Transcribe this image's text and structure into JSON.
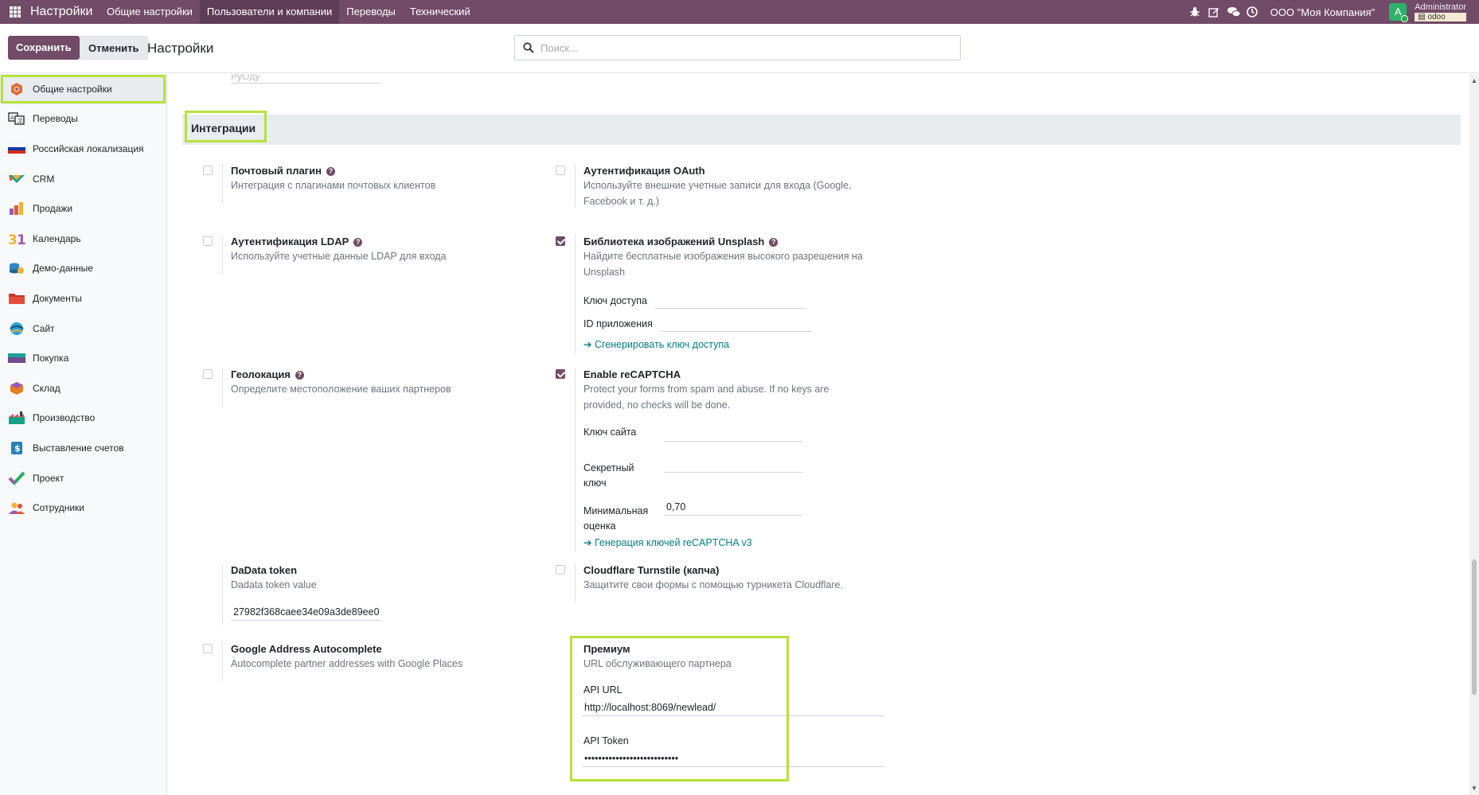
{
  "topbar": {
    "app_name": "Настройки",
    "menu": [
      "Общие настройки",
      "Пользователи и компании",
      "Переводы",
      "Технический"
    ],
    "active_menu_index": 1,
    "company": "ООО \"Моя Компания\"",
    "avatar_letter": "A",
    "user_name": "Administrator",
    "db_name": "odoo",
    "tray_icons": [
      "bug-icon",
      "edit-icon",
      "chat-icon",
      "clock-icon"
    ]
  },
  "control": {
    "save_label": "Сохранить",
    "cancel_label": "Отменить",
    "title": "Настройки",
    "search_placeholder": "Поиск..."
  },
  "sidebar": {
    "items": [
      {
        "label": "Общие настройки",
        "icon": "settings-app-icon",
        "color": "#e06a3b",
        "active": true
      },
      {
        "label": "Переводы",
        "icon": "translate-icon",
        "color": "#333333"
      },
      {
        "label": "Российская локализация",
        "icon": "russia-flag-icon",
        "color": "#d52b1e"
      },
      {
        "label": "CRM",
        "icon": "crm-icon",
        "color": "#1aa29b"
      },
      {
        "label": "Продажи",
        "icon": "sales-icon",
        "color": "#e65a2c"
      },
      {
        "label": "Календарь",
        "icon": "calendar-icon",
        "color": "#e67e22"
      },
      {
        "label": "Демо-данные",
        "icon": "demo-data-icon",
        "color": "#2e86c1"
      },
      {
        "label": "Документы",
        "icon": "documents-icon",
        "color": "#c0392b"
      },
      {
        "label": "Сайт",
        "icon": "website-icon",
        "color": "#2aa3d6"
      },
      {
        "label": "Покупка",
        "icon": "purchase-icon",
        "color": "#6d4b8d"
      },
      {
        "label": "Склад",
        "icon": "inventory-icon",
        "color": "#e67e22"
      },
      {
        "label": "Производство",
        "icon": "manufacturing-icon",
        "color": "#16a085"
      },
      {
        "label": "Выставление счетов",
        "icon": "invoicing-icon",
        "color": "#2980b9"
      },
      {
        "label": "Проект",
        "icon": "project-icon",
        "color": "#27ae60"
      },
      {
        "label": "Сотрудники",
        "icon": "employees-icon",
        "color": "#9b59b6"
      }
    ]
  },
  "main": {
    "prev_field_value": "PyOдy",
    "section_title": "Интеграции",
    "mail_plugin": {
      "title": "Почтовый плагин",
      "desc": "Интеграция с плагинами почтовых клиентов",
      "checked": false
    },
    "oauth": {
      "title": "Аутентификация OAuth",
      "desc": "Используйте внешние учетные записи для входа (Google, Facebook и т. д.)",
      "checked": false
    },
    "ldap": {
      "title": "Аутентификация LDAP",
      "desc": "Используйте учетные данные LDAP для входа",
      "checked": false
    },
    "unsplash": {
      "title": "Библиотека изображений Unsplash",
      "desc": "Найдите бесплатные изображения высокого разрешения на Unsplash",
      "checked": true,
      "access_key_label": "Ключ доступа",
      "access_key_value": "",
      "app_id_label": "ID приложения",
      "app_id_value": "",
      "link": "Сгенерировать ключ доступа"
    },
    "geo": {
      "title": "Геолокация",
      "desc": "Определите местоположение ваших партнеров",
      "checked": false
    },
    "recaptcha": {
      "title": "Enable reCAPTCHA",
      "desc": "Protect your forms from spam and abuse. If no keys are provided, no checks will be done.",
      "checked": true,
      "site_key_label": "Ключ сайта",
      "site_key_value": "",
      "secret_key_label": "Секретный ключ",
      "secret_key_value": "",
      "min_score_label": "Минимальная оценка",
      "min_score_value": "0,70",
      "link": "Генерация ключей reCAPTCHA v3"
    },
    "dadata": {
      "title": "DaData token",
      "desc": "Dadata token value",
      "value": "27982f368caee34e09a3de89ee0"
    },
    "turnstile": {
      "title": "Cloudflare Turnstile (капча)",
      "desc": "Защитите свои формы с помощью турникета Cloudflare.",
      "checked": false
    },
    "google_autocomplete": {
      "title": "Google Address Autocomplete",
      "desc": "Autocomplete partner addresses with Google Places",
      "checked": false
    },
    "premium": {
      "title": "Премиум",
      "desc": "URL обслуживающего партнера",
      "api_url_label": "API URL",
      "api_url_value": "http://localhost:8069/newlead/",
      "api_token_label": "API Token",
      "api_token_value": "•••••••••••••••••••••••••••"
    }
  }
}
